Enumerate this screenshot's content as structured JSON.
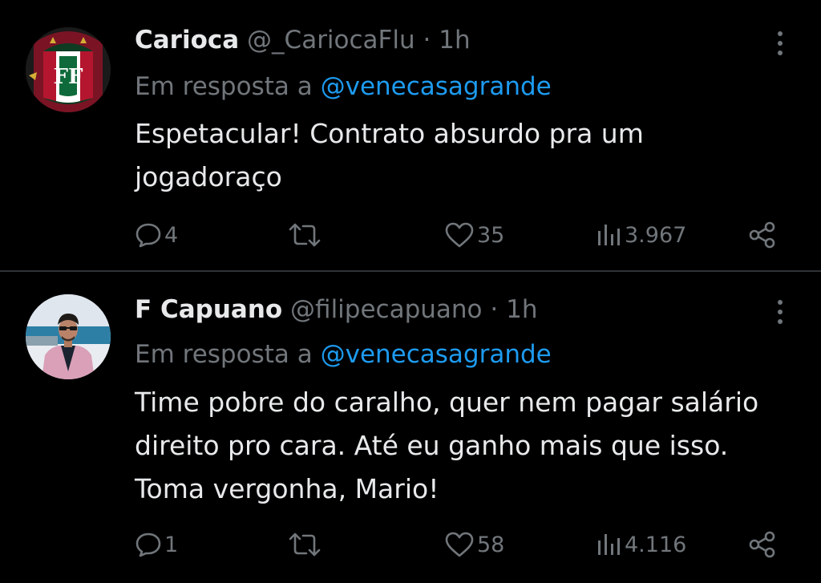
{
  "tweets": [
    {
      "display_name": "Carioca",
      "handle": "@_CariocaFlu",
      "separator": "·",
      "time": "1h",
      "reply_prefix": "Em resposta a",
      "reply_to": "@venecasagrande",
      "text": "Espetacular! Contrato absurdo pra um jogadoraço",
      "replies": "4",
      "retweets": "",
      "likes": "35",
      "views": "3.967"
    },
    {
      "display_name": "F Capuano",
      "handle": "@filipecapuano",
      "separator": "·",
      "time": "1h",
      "reply_prefix": "Em resposta a",
      "reply_to": "@venecasagrande",
      "text": "Time pobre do caralho, quer nem pagar salário direito pro cara. Até eu ganho mais que isso. Toma vergonha, Mario!",
      "replies": "1",
      "retweets": "",
      "likes": "58",
      "views": "4.116"
    }
  ],
  "icons": {
    "reply": "speech-bubble-icon",
    "retweet": "retweet-arrows-icon",
    "like": "heart-outline-icon",
    "views": "bar-chart-icon",
    "share": "share-nodes-icon",
    "more": "vertical-ellipsis-icon"
  },
  "colors": {
    "background": "#000000",
    "primary_text": "#e7e9ea",
    "secondary_text": "#71767b",
    "link": "#1d9bf0",
    "divider": "#2f3336"
  }
}
